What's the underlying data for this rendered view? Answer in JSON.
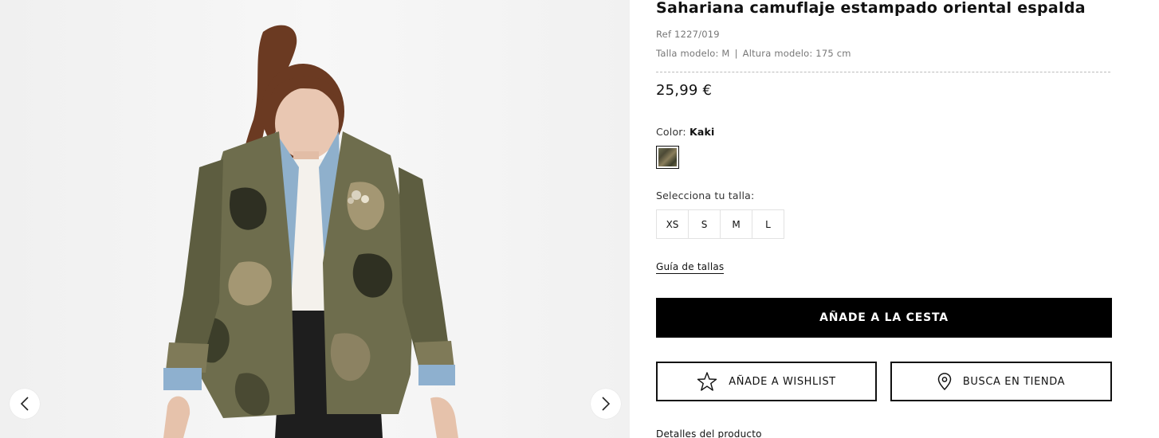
{
  "product": {
    "title": "Sahariana camuflaje estampado oriental espalda",
    "ref": "Ref 1227/019",
    "model_size": "Talla modelo: M",
    "model_separator": "|",
    "model_height": "Altura modelo: 175 cm",
    "price": "25,99 €"
  },
  "color": {
    "label": "Color:",
    "selected": "Kaki",
    "swatch_colors": [
      "#6a6b4e",
      "#4d4a36",
      "#8a7e5c",
      "#3d3f2c"
    ]
  },
  "sizes": {
    "label": "Selecciona tu talla:",
    "options": [
      "XS",
      "S",
      "M",
      "L"
    ]
  },
  "size_guide": "Guía de tallas",
  "buttons": {
    "add_to_cart": "AÑADE A LA CESTA",
    "wishlist": "AÑADE A WISHLIST",
    "find_store": "BUSCA EN TIENDA"
  },
  "details_label": "Detalles del producto",
  "gallery": {
    "prev_icon": "chevron-left-icon",
    "next_icon": "chevron-right-icon"
  },
  "colors": {
    "primary_button": "#000000",
    "background": "#ffffff",
    "muted_text": "#777777"
  }
}
